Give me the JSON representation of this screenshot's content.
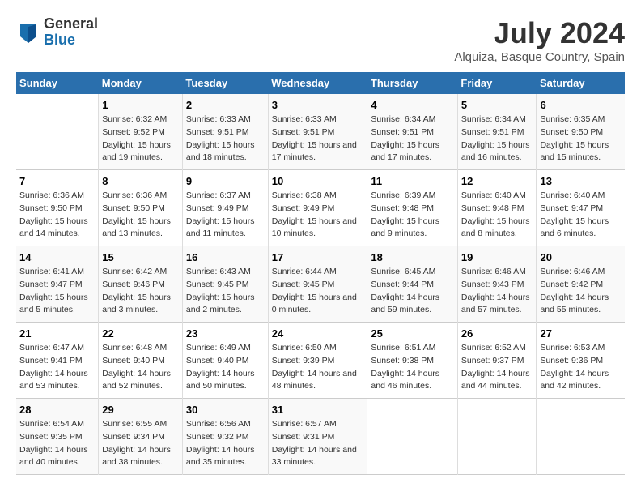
{
  "header": {
    "logo_general": "General",
    "logo_blue": "Blue",
    "title": "July 2024",
    "location": "Alquiza, Basque Country, Spain"
  },
  "days_of_week": [
    "Sunday",
    "Monday",
    "Tuesday",
    "Wednesday",
    "Thursday",
    "Friday",
    "Saturday"
  ],
  "weeks": [
    [
      {
        "day": "",
        "content": ""
      },
      {
        "day": "1",
        "content": "Sunrise: 6:32 AM\nSunset: 9:52 PM\nDaylight: 15 hours\nand 19 minutes."
      },
      {
        "day": "2",
        "content": "Sunrise: 6:33 AM\nSunset: 9:51 PM\nDaylight: 15 hours\nand 18 minutes."
      },
      {
        "day": "3",
        "content": "Sunrise: 6:33 AM\nSunset: 9:51 PM\nDaylight: 15 hours\nand 17 minutes."
      },
      {
        "day": "4",
        "content": "Sunrise: 6:34 AM\nSunset: 9:51 PM\nDaylight: 15 hours\nand 17 minutes."
      },
      {
        "day": "5",
        "content": "Sunrise: 6:34 AM\nSunset: 9:51 PM\nDaylight: 15 hours\nand 16 minutes."
      },
      {
        "day": "6",
        "content": "Sunrise: 6:35 AM\nSunset: 9:50 PM\nDaylight: 15 hours\nand 15 minutes."
      }
    ],
    [
      {
        "day": "7",
        "content": "Sunrise: 6:36 AM\nSunset: 9:50 PM\nDaylight: 15 hours\nand 14 minutes."
      },
      {
        "day": "8",
        "content": "Sunrise: 6:36 AM\nSunset: 9:50 PM\nDaylight: 15 hours\nand 13 minutes."
      },
      {
        "day": "9",
        "content": "Sunrise: 6:37 AM\nSunset: 9:49 PM\nDaylight: 15 hours\nand 11 minutes."
      },
      {
        "day": "10",
        "content": "Sunrise: 6:38 AM\nSunset: 9:49 PM\nDaylight: 15 hours\nand 10 minutes."
      },
      {
        "day": "11",
        "content": "Sunrise: 6:39 AM\nSunset: 9:48 PM\nDaylight: 15 hours\nand 9 minutes."
      },
      {
        "day": "12",
        "content": "Sunrise: 6:40 AM\nSunset: 9:48 PM\nDaylight: 15 hours\nand 8 minutes."
      },
      {
        "day": "13",
        "content": "Sunrise: 6:40 AM\nSunset: 9:47 PM\nDaylight: 15 hours\nand 6 minutes."
      }
    ],
    [
      {
        "day": "14",
        "content": "Sunrise: 6:41 AM\nSunset: 9:47 PM\nDaylight: 15 hours\nand 5 minutes."
      },
      {
        "day": "15",
        "content": "Sunrise: 6:42 AM\nSunset: 9:46 PM\nDaylight: 15 hours\nand 3 minutes."
      },
      {
        "day": "16",
        "content": "Sunrise: 6:43 AM\nSunset: 9:45 PM\nDaylight: 15 hours\nand 2 minutes."
      },
      {
        "day": "17",
        "content": "Sunrise: 6:44 AM\nSunset: 9:45 PM\nDaylight: 15 hours\nand 0 minutes."
      },
      {
        "day": "18",
        "content": "Sunrise: 6:45 AM\nSunset: 9:44 PM\nDaylight: 14 hours\nand 59 minutes."
      },
      {
        "day": "19",
        "content": "Sunrise: 6:46 AM\nSunset: 9:43 PM\nDaylight: 14 hours\nand 57 minutes."
      },
      {
        "day": "20",
        "content": "Sunrise: 6:46 AM\nSunset: 9:42 PM\nDaylight: 14 hours\nand 55 minutes."
      }
    ],
    [
      {
        "day": "21",
        "content": "Sunrise: 6:47 AM\nSunset: 9:41 PM\nDaylight: 14 hours\nand 53 minutes."
      },
      {
        "day": "22",
        "content": "Sunrise: 6:48 AM\nSunset: 9:40 PM\nDaylight: 14 hours\nand 52 minutes."
      },
      {
        "day": "23",
        "content": "Sunrise: 6:49 AM\nSunset: 9:40 PM\nDaylight: 14 hours\nand 50 minutes."
      },
      {
        "day": "24",
        "content": "Sunrise: 6:50 AM\nSunset: 9:39 PM\nDaylight: 14 hours\nand 48 minutes."
      },
      {
        "day": "25",
        "content": "Sunrise: 6:51 AM\nSunset: 9:38 PM\nDaylight: 14 hours\nand 46 minutes."
      },
      {
        "day": "26",
        "content": "Sunrise: 6:52 AM\nSunset: 9:37 PM\nDaylight: 14 hours\nand 44 minutes."
      },
      {
        "day": "27",
        "content": "Sunrise: 6:53 AM\nSunset: 9:36 PM\nDaylight: 14 hours\nand 42 minutes."
      }
    ],
    [
      {
        "day": "28",
        "content": "Sunrise: 6:54 AM\nSunset: 9:35 PM\nDaylight: 14 hours\nand 40 minutes."
      },
      {
        "day": "29",
        "content": "Sunrise: 6:55 AM\nSunset: 9:34 PM\nDaylight: 14 hours\nand 38 minutes."
      },
      {
        "day": "30",
        "content": "Sunrise: 6:56 AM\nSunset: 9:32 PM\nDaylight: 14 hours\nand 35 minutes."
      },
      {
        "day": "31",
        "content": "Sunrise: 6:57 AM\nSunset: 9:31 PM\nDaylight: 14 hours\nand 33 minutes."
      },
      {
        "day": "",
        "content": ""
      },
      {
        "day": "",
        "content": ""
      },
      {
        "day": "",
        "content": ""
      }
    ]
  ]
}
